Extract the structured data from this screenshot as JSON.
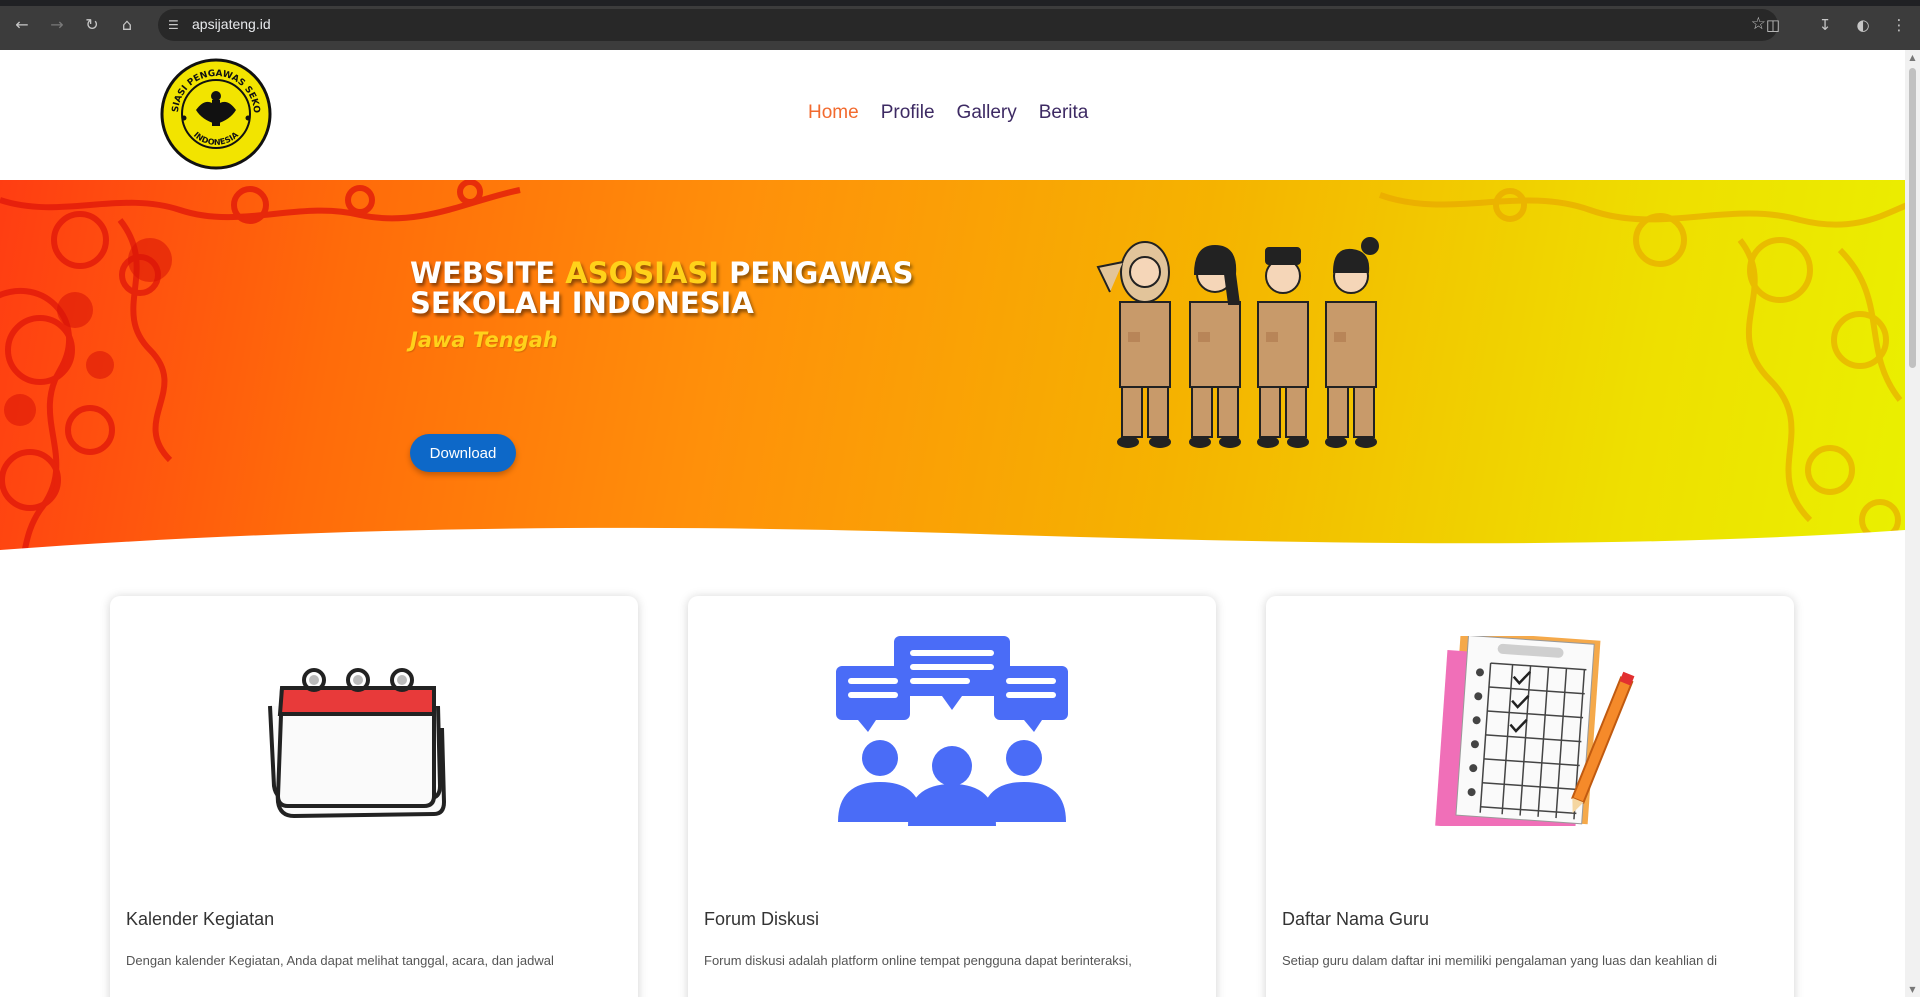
{
  "browser": {
    "url": "apsijateng.id",
    "icons": [
      "back-icon",
      "forward-icon",
      "reload-icon",
      "home-icon",
      "site-info-icon",
      "bookmark-star-icon",
      "extensions-icon",
      "download-icon",
      "profile-icon",
      "menu-icon"
    ]
  },
  "header": {
    "logo_text_top": "ASOSIASI PENGAWAS SEKOLAH",
    "logo_text_bottom": "INDONESIA",
    "nav": [
      {
        "label": "Home",
        "active": true
      },
      {
        "label": "Profile",
        "active": false
      },
      {
        "label": "Gallery",
        "active": false
      },
      {
        "label": "Berita",
        "active": false
      }
    ]
  },
  "hero": {
    "title_part1": "WEBSITE ",
    "title_highlight": "ASOSIASI",
    "title_part2": " PENGAWAS SEKOLAH INDONESIA",
    "subtitle": "Jawa Tengah",
    "button_label": "Download",
    "colors": {
      "start": "#ff3d12",
      "mid": "#ff900a",
      "end": "#eaf000",
      "highlight": "#ffd21a",
      "button": "#0d68c8"
    }
  },
  "cards": [
    {
      "title": "Kalender Kegiatan",
      "description": "Dengan kalender Kegiatan, Anda dapat melihat tanggal, acara, dan jadwal",
      "icon": "calendar-icon"
    },
    {
      "title": "Forum Diskusi",
      "description": "Forum diskusi adalah platform online tempat pengguna dapat berinteraksi,",
      "icon": "discussion-forum-icon"
    },
    {
      "title": "Daftar Nama Guru",
      "description": "Setiap guru dalam daftar ini memiliki pengalaman yang luas dan keahlian di",
      "icon": "teacher-list-icon"
    }
  ]
}
